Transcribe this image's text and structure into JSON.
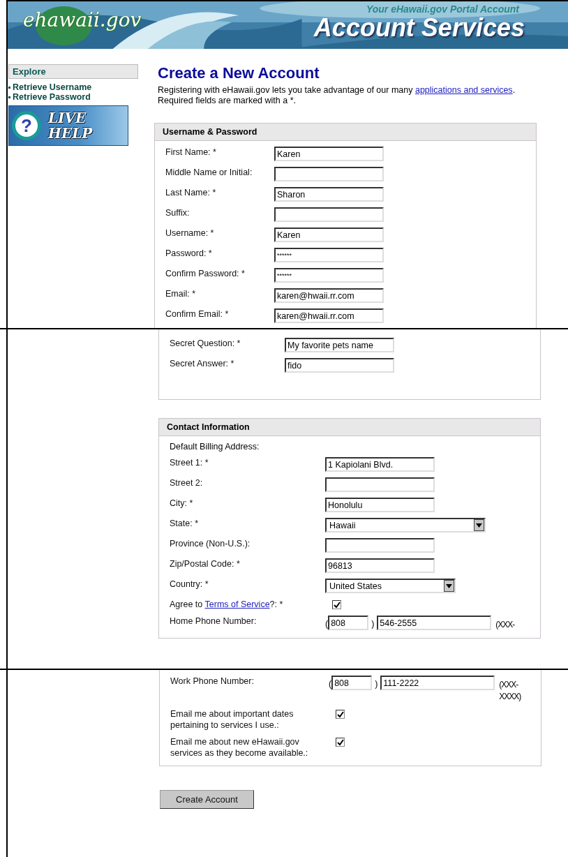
{
  "header": {
    "logo": "ehawaii.gov",
    "tagline": "Your eHawaii.gov Portal Account",
    "title": "Account Services"
  },
  "sidebar": {
    "heading": "Explore",
    "links": [
      "Retrieve Username",
      "Retrieve Password"
    ],
    "live_help": {
      "mark": "?",
      "lines": [
        "LIVE",
        "HELP"
      ]
    }
  },
  "main": {
    "title": "Create a New Account",
    "intro": {
      "before": "Registering with eHawaii.gov lets you take advantage of our many ",
      "link": "applications and services",
      "after": ". Required fields are marked with a *."
    }
  },
  "segments": [
    {
      "sections": [
        {
          "heading": "Username & Password",
          "rows": [
            {
              "kind": "text",
              "label": "First Name: *",
              "value": "Karen"
            },
            {
              "kind": "text",
              "label": "Middle Name or Initial:"
            },
            {
              "kind": "text",
              "label": "Last Name: *",
              "value": "Sharon"
            },
            {
              "kind": "text",
              "label": "Suffix:"
            },
            {
              "kind": "text",
              "label": "Username: *",
              "value": "Karen"
            },
            {
              "kind": "password",
              "label": "Password: *",
              "value": "******"
            },
            {
              "kind": "password",
              "label": "Confirm Password: *",
              "value": "******"
            },
            {
              "kind": "text",
              "label": "Email: *",
              "value": "karen@hwaii.rr.com"
            },
            {
              "kind": "text",
              "label": "Confirm Email: *",
              "value": "karen@hwaii.rr.com"
            }
          ]
        }
      ]
    },
    {
      "sections": [
        {
          "rows": [
            {
              "kind": "text",
              "label": "Secret Question: *",
              "value": "My favorite pets name"
            },
            {
              "kind": "text",
              "label": "Secret Answer: *",
              "value": "fido"
            }
          ]
        },
        {
          "heading": "Contact Information",
          "rows": [
            {
              "kind": "note",
              "label": "Default Billing Address:"
            },
            {
              "kind": "text",
              "label": "Street 1: *",
              "value": "1 Kapiolani Blvd."
            },
            {
              "kind": "text",
              "label": "Street 2:"
            },
            {
              "kind": "text",
              "label": "City: *",
              "value": "Honolulu"
            },
            {
              "kind": "select",
              "label": "State: *",
              "value": "Hawaii"
            },
            {
              "kind": "text",
              "label": "Province (Non-U.S.):"
            },
            {
              "kind": "text",
              "label": "Zip/Postal Code: *",
              "value": "96813"
            },
            {
              "kind": "select",
              "label": "Country: *",
              "value": "United States"
            },
            {
              "kind": "checkbox",
              "label": "Agree to ",
              "label_link": "Terms of Service",
              "label_after": "?: *",
              "checked": true
            },
            {
              "kind": "phone",
              "label": "Home Phone Number:",
              "open": "(",
              "area": "808",
              "close": ")",
              "number": "546-2555",
              "hint": "(XXX-"
            }
          ]
        }
      ]
    },
    {
      "sections": [
        {
          "rows": [
            {
              "kind": "phone",
              "label": "Work Phone Number:",
              "open": "(",
              "area": "808",
              "close": ")",
              "number": "111-2222",
              "hint": "(XXX-XXXX)"
            },
            {
              "kind": "checkbox",
              "label": "Email me about important dates pertaining to services I use.:",
              "checked": true
            },
            {
              "kind": "checkbox",
              "label": "Email me about new eHawaii.gov services as they become available.:",
              "checked": true
            }
          ]
        }
      ],
      "button": "Create Account"
    }
  ]
}
